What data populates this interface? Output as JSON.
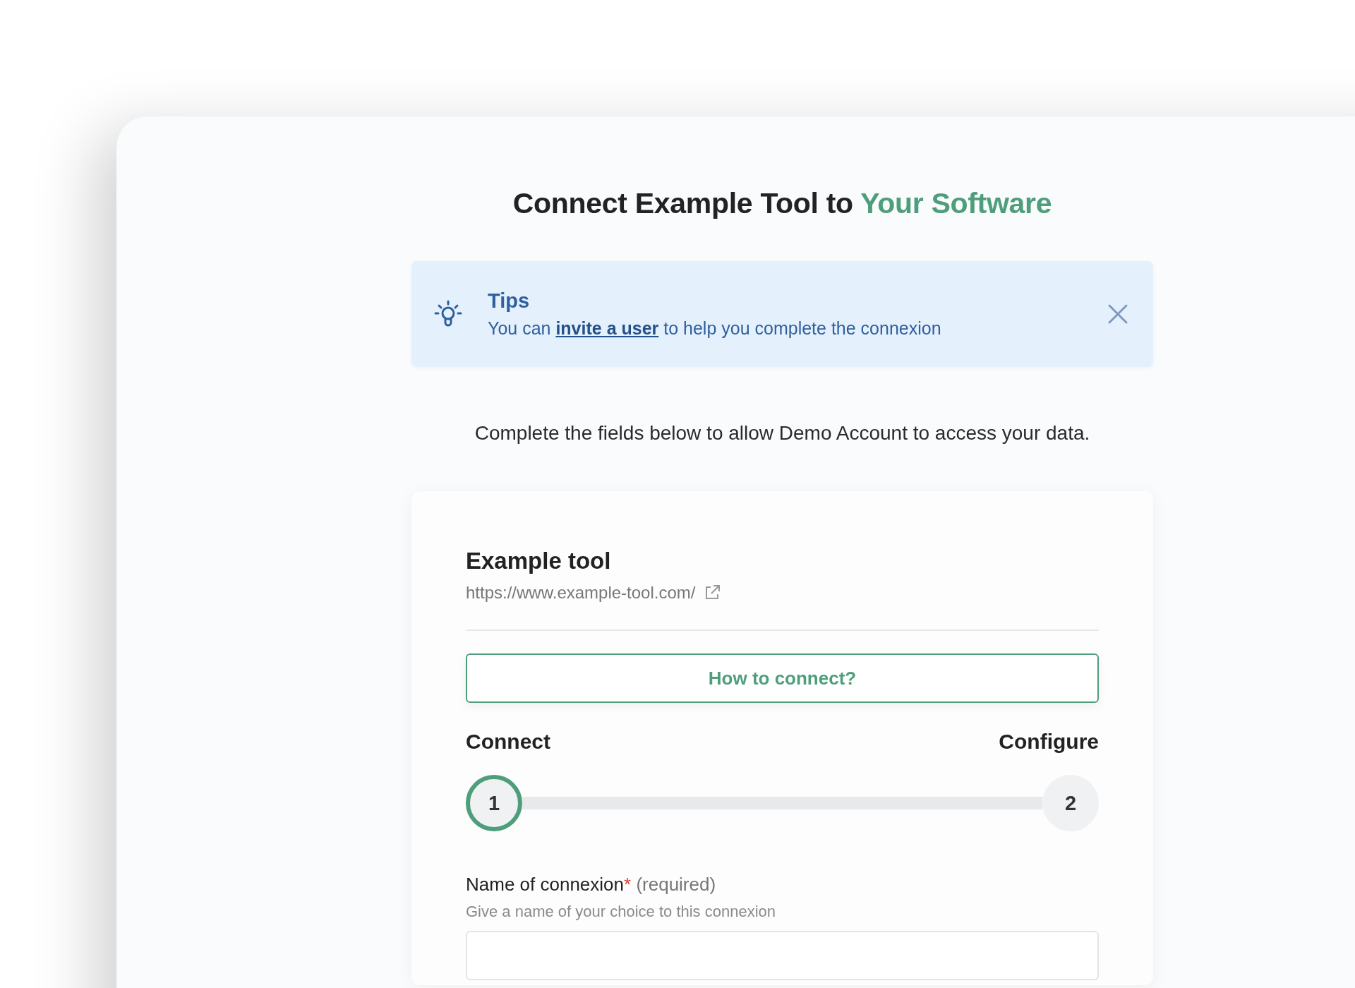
{
  "title": {
    "text": "Connect Example Tool to",
    "accent": "Your Software"
  },
  "tips": {
    "title": "Tips",
    "text_before": "You can",
    "link": "invite a user",
    "text_after": "to help you complete the connexion"
  },
  "intro": "Complete the fields below to allow Demo Account to access your data.",
  "card": {
    "tool_name": "Example tool",
    "url": "https://www.example-tool.com/",
    "button": "How to connect?",
    "steps": [
      {
        "number": "1",
        "label": "Connect",
        "selected": true
      },
      {
        "number": "2",
        "label": "Configure",
        "selected": false
      }
    ],
    "field": {
      "label": "Name of connexion",
      "required_mark": "*",
      "required_text": "(required)",
      "hint": "Give a name of your choice to this connexion"
    }
  }
}
